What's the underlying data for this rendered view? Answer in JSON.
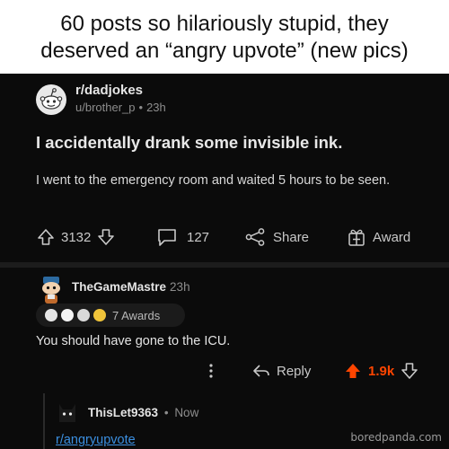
{
  "headline": {
    "line1": "60 posts so hilariously stupid, they",
    "line2": "deserved an “angry upvote” (new pics)"
  },
  "post": {
    "subreddit": "r/dadjokes",
    "user": "u/brother_p",
    "separator": "•",
    "age": "23h",
    "title": "I accidentally drank some invisible ink.",
    "body": "I went to the emergency room and waited 5 hours to be seen.",
    "actions": {
      "votes": "3132",
      "comments": "127",
      "share": "Share",
      "award": "Award"
    },
    "icons": [
      "reddit-snoo-icon",
      "upvote-icon",
      "downvote-icon",
      "comment-icon",
      "share-icon",
      "award-gift-icon"
    ]
  },
  "comment": {
    "user": "TheGameMastre",
    "age": "23h",
    "awards_label": "7 Awards",
    "text": "You should have gone to the ICU.",
    "actions": {
      "reply": "Reply",
      "votes": "1.9k"
    },
    "upvote_color": "#ff4500"
  },
  "reply": {
    "user": "ThisLet9363",
    "separator": "•",
    "age": "Now",
    "link": "r/angryupvote"
  },
  "watermark": "boredpanda.com"
}
